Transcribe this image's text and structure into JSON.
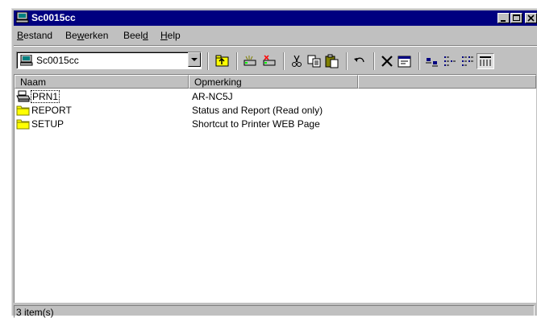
{
  "window": {
    "title": "Sc0015cc",
    "controls": [
      "minimize",
      "maximize",
      "close"
    ]
  },
  "menu": {
    "items": [
      {
        "label": "Bestand",
        "accelerator": "B"
      },
      {
        "label": "Bewerken",
        "accelerator": "w"
      },
      {
        "label": "Beeld",
        "accelerator": "d"
      },
      {
        "label": "Help",
        "accelerator": "H"
      }
    ]
  },
  "toolbar": {
    "address_value": "Sc0015cc",
    "buttons": [
      "up-one-level",
      "map-network-drive",
      "disconnect-network-drive",
      "cut",
      "copy",
      "paste",
      "undo",
      "delete",
      "properties",
      "large-icons",
      "small-icons",
      "list",
      "details"
    ],
    "active_view": "details"
  },
  "list": {
    "columns": [
      "Naam",
      "Opmerking"
    ],
    "rows": [
      {
        "name": "PRN1",
        "note": "AR-NC5J",
        "icon": "printer-icon"
      },
      {
        "name": "REPORT",
        "note": "Status and Report (Read only)",
        "icon": "folder-icon"
      },
      {
        "name": "SETUP",
        "note": "Shortcut to Printer WEB Page",
        "icon": "folder-icon"
      }
    ]
  },
  "status": {
    "text": "3 item(s)"
  },
  "colors": {
    "titlebar": "#000080",
    "face": "#c0c0c0",
    "folder": "#ffff00"
  }
}
